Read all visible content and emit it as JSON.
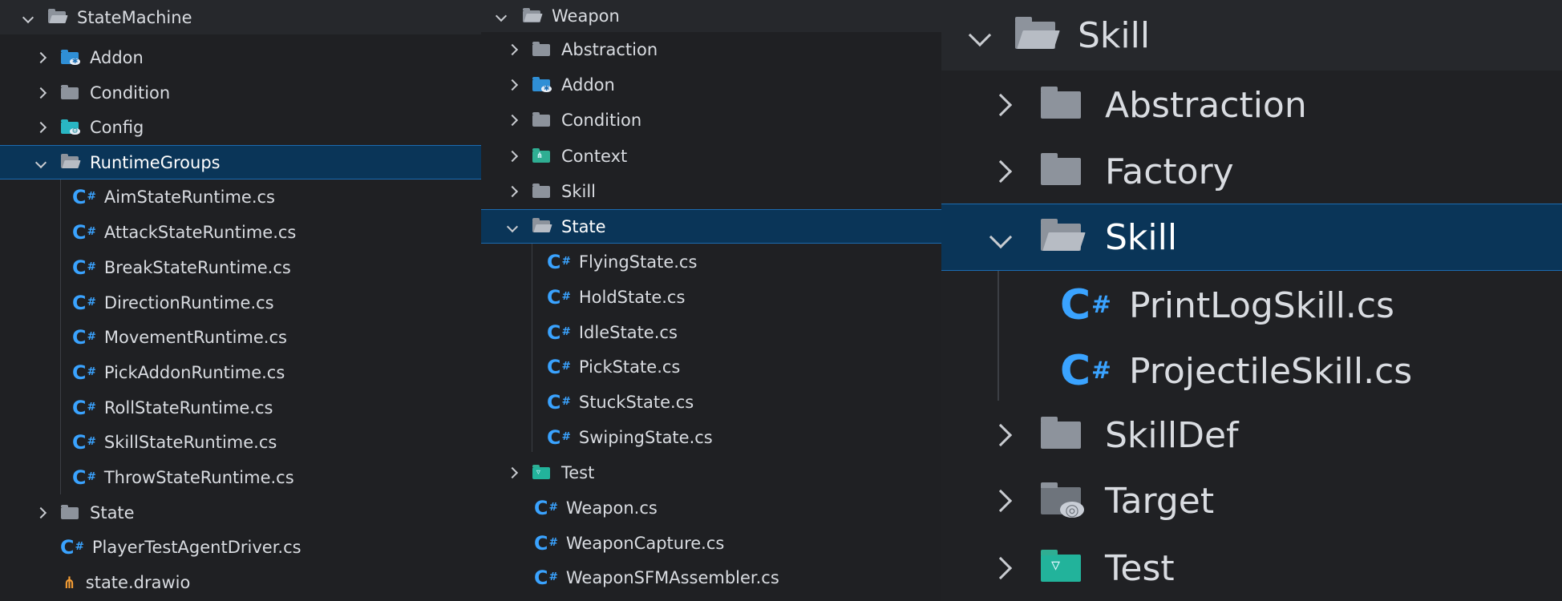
{
  "panel1": {
    "root": {
      "label": "StateMachine",
      "icon": "folder-open-icon"
    },
    "items": [
      {
        "label": "Addon",
        "icon": "folder-addon-icon"
      },
      {
        "label": "Condition",
        "icon": "folder-icon"
      },
      {
        "label": "Config",
        "icon": "folder-config-icon"
      },
      {
        "label": "RuntimeGroups",
        "icon": "folder-open-icon"
      },
      {
        "label": "AimStateRuntime.cs",
        "icon": "csharp-file-icon"
      },
      {
        "label": "AttackStateRuntime.cs",
        "icon": "csharp-file-icon"
      },
      {
        "label": "BreakStateRuntime.cs",
        "icon": "csharp-file-icon"
      },
      {
        "label": "DirectionRuntime.cs",
        "icon": "csharp-file-icon"
      },
      {
        "label": "MovementRuntime.cs",
        "icon": "csharp-file-icon"
      },
      {
        "label": "PickAddonRuntime.cs",
        "icon": "csharp-file-icon"
      },
      {
        "label": "RollStateRuntime.cs",
        "icon": "csharp-file-icon"
      },
      {
        "label": "SkillStateRuntime.cs",
        "icon": "csharp-file-icon"
      },
      {
        "label": "ThrowStateRuntime.cs",
        "icon": "csharp-file-icon"
      },
      {
        "label": "State",
        "icon": "folder-icon"
      },
      {
        "label": "PlayerTestAgentDriver.cs",
        "icon": "csharp-file-icon"
      },
      {
        "label": "state.drawio",
        "icon": "drawio-file-icon"
      }
    ]
  },
  "panel2": {
    "root": {
      "label": "Weapon",
      "icon": "folder-open-icon"
    },
    "items": [
      {
        "label": "Abstraction",
        "icon": "folder-icon"
      },
      {
        "label": "Addon",
        "icon": "folder-addon-icon"
      },
      {
        "label": "Condition",
        "icon": "folder-icon"
      },
      {
        "label": "Context",
        "icon": "folder-context-icon"
      },
      {
        "label": "Skill",
        "icon": "folder-icon"
      },
      {
        "label": "State",
        "icon": "folder-open-icon"
      },
      {
        "label": "FlyingState.cs",
        "icon": "csharp-file-icon"
      },
      {
        "label": "HoldState.cs",
        "icon": "csharp-file-icon"
      },
      {
        "label": "IdleState.cs",
        "icon": "csharp-file-icon"
      },
      {
        "label": "PickState.cs",
        "icon": "csharp-file-icon"
      },
      {
        "label": "StuckState.cs",
        "icon": "csharp-file-icon"
      },
      {
        "label": "SwipingState.cs",
        "icon": "csharp-file-icon"
      },
      {
        "label": "Test",
        "icon": "folder-test-icon"
      },
      {
        "label": "Weapon.cs",
        "icon": "csharp-file-icon"
      },
      {
        "label": "WeaponCapture.cs",
        "icon": "csharp-file-icon"
      },
      {
        "label": "WeaponSFMAssembler.cs",
        "icon": "csharp-file-icon"
      }
    ]
  },
  "panel3": {
    "root": {
      "label": "Skill",
      "icon": "folder-open-icon"
    },
    "items": [
      {
        "label": "Abstraction",
        "icon": "folder-icon"
      },
      {
        "label": "Factory",
        "icon": "folder-icon"
      },
      {
        "label": "Skill",
        "icon": "folder-open-icon"
      },
      {
        "label": "PrintLogSkill.cs",
        "icon": "csharp-file-icon"
      },
      {
        "label": "ProjectileSkill.cs",
        "icon": "csharp-file-icon"
      },
      {
        "label": "SkillDef",
        "icon": "folder-icon"
      },
      {
        "label": "Target",
        "icon": "folder-target-icon"
      },
      {
        "label": "Test",
        "icon": "folder-test-icon"
      }
    ]
  },
  "colors": {
    "background": "#1f2023",
    "selection": "#0a3558",
    "selection_border": "#1c6bb0",
    "csharp_icon": "#3aa3ff",
    "folder_icon": "#8d939c",
    "text": "#d9dce1"
  }
}
